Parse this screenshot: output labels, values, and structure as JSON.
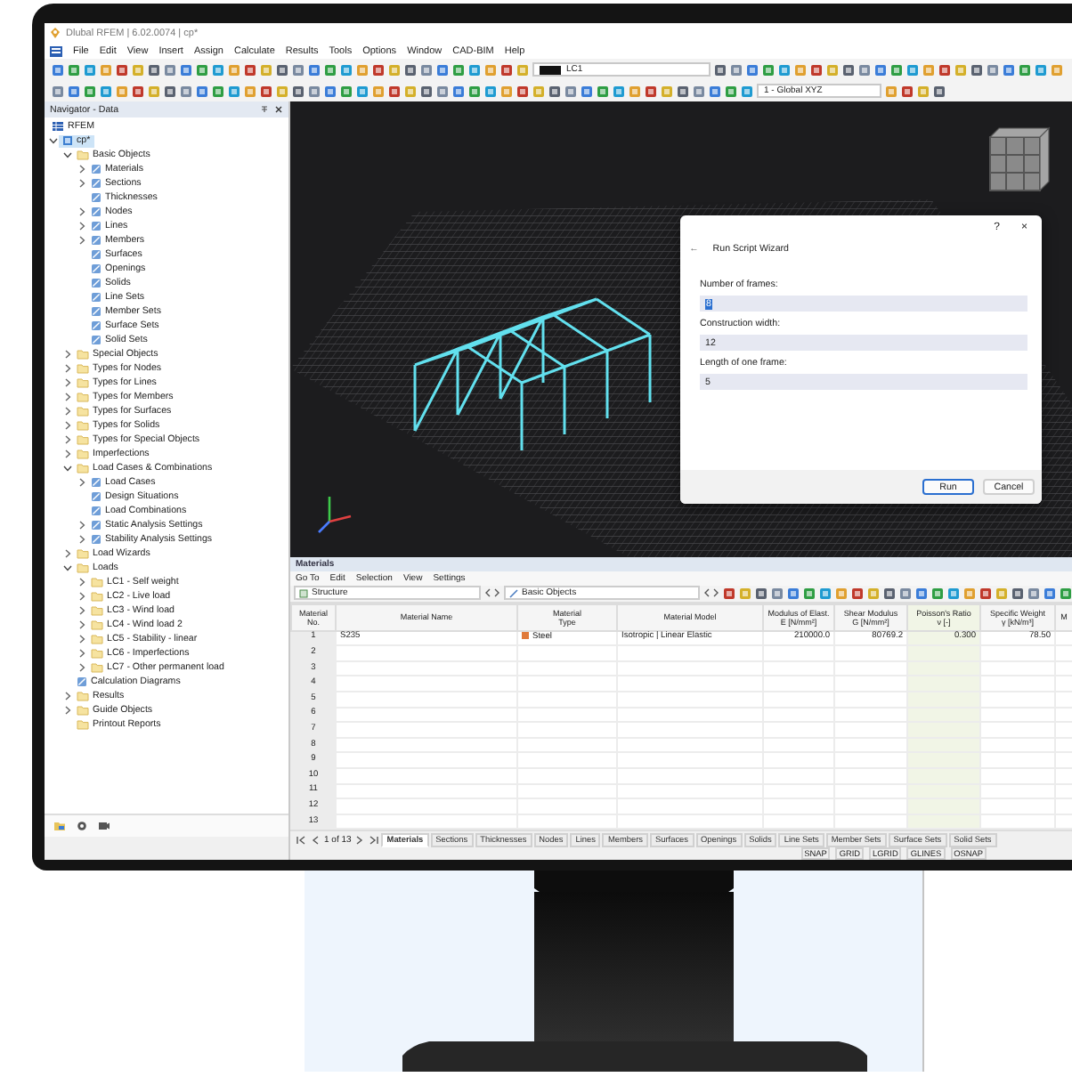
{
  "window": {
    "title": "Dlubal RFEM | 6.02.0074 | cp*"
  },
  "menu": [
    "File",
    "Edit",
    "View",
    "Insert",
    "Assign",
    "Calculate",
    "Results",
    "Tools",
    "Options",
    "Window",
    "CAD-BIM",
    "Help"
  ],
  "toolbar": {
    "load_case": "LC1",
    "view": "1 - Global XYZ"
  },
  "navigator": {
    "title": "Navigator - Data",
    "tree": [
      {
        "label": "RFEM",
        "kind": "app",
        "selected": false
      },
      {
        "label": "cp*",
        "kind": "model",
        "selected": true,
        "expanded": true,
        "children": [
          {
            "label": "Basic Objects",
            "kind": "folder",
            "selected": false,
            "expanded": true,
            "children": [
              {
                "label": "Materials",
                "kind": "object",
                "selected": false,
                "expanded": false
              },
              {
                "label": "Sections",
                "kind": "object",
                "selected": false,
                "expanded": false
              },
              {
                "label": "Thicknesses",
                "kind": "object",
                "selected": false
              },
              {
                "label": "Nodes",
                "kind": "object",
                "selected": false,
                "expanded": false
              },
              {
                "label": "Lines",
                "kind": "object",
                "selected": false,
                "expanded": false
              },
              {
                "label": "Members",
                "kind": "object",
                "selected": false,
                "expanded": false
              },
              {
                "label": "Surfaces",
                "kind": "object",
                "selected": false
              },
              {
                "label": "Openings",
                "kind": "object",
                "selected": false
              },
              {
                "label": "Solids",
                "kind": "object",
                "selected": false
              },
              {
                "label": "Line Sets",
                "kind": "object",
                "selected": false
              },
              {
                "label": "Member Sets",
                "kind": "object",
                "selected": false
              },
              {
                "label": "Surface Sets",
                "kind": "object",
                "selected": false
              },
              {
                "label": "Solid Sets",
                "kind": "object",
                "selected": false
              }
            ]
          },
          {
            "label": "Special Objects",
            "kind": "folder",
            "selected": false,
            "expanded": false
          },
          {
            "label": "Types for Nodes",
            "kind": "folder",
            "selected": false,
            "expanded": false
          },
          {
            "label": "Types for Lines",
            "kind": "folder",
            "selected": false,
            "expanded": false
          },
          {
            "label": "Types for Members",
            "kind": "folder",
            "selected": false,
            "expanded": false
          },
          {
            "label": "Types for Surfaces",
            "kind": "folder",
            "selected": false,
            "expanded": false
          },
          {
            "label": "Types for Solids",
            "kind": "folder",
            "selected": false,
            "expanded": false
          },
          {
            "label": "Types for Special Objects",
            "kind": "folder",
            "selected": false,
            "expanded": false
          },
          {
            "label": "Imperfections",
            "kind": "folder",
            "selected": false,
            "expanded": false
          },
          {
            "label": "Load Cases & Combinations",
            "kind": "folder",
            "selected": false,
            "expanded": true,
            "children": [
              {
                "label": "Load Cases",
                "kind": "object",
                "selected": false,
                "expanded": false
              },
              {
                "label": "Design Situations",
                "kind": "object",
                "selected": false
              },
              {
                "label": "Load Combinations",
                "kind": "object",
                "selected": false
              },
              {
                "label": "Static Analysis Settings",
                "kind": "object",
                "selected": false,
                "expanded": false
              },
              {
                "label": "Stability Analysis Settings",
                "kind": "object",
                "selected": false,
                "expanded": false
              }
            ]
          },
          {
            "label": "Load Wizards",
            "kind": "folder",
            "selected": false,
            "expanded": false
          },
          {
            "label": "Loads",
            "kind": "folder",
            "selected": false,
            "expanded": true,
            "children": [
              {
                "label": "LC1 - Self weight",
                "kind": "folder",
                "selected": false,
                "expanded": false
              },
              {
                "label": "LC2 - Live load",
                "kind": "folder",
                "selected": false,
                "expanded": false
              },
              {
                "label": "LC3 - Wind load",
                "kind": "folder",
                "selected": false,
                "expanded": false
              },
              {
                "label": "LC4 - Wind load 2",
                "kind": "folder",
                "selected": false,
                "expanded": false
              },
              {
                "label": "LC5 - Stability - linear",
                "kind": "folder",
                "selected": false,
                "expanded": false
              },
              {
                "label": "LC6 - Imperfections",
                "kind": "folder",
                "selected": false,
                "expanded": false
              },
              {
                "label": "LC7 - Other permanent load",
                "kind": "folder",
                "selected": false,
                "expanded": false
              }
            ]
          },
          {
            "label": "Calculation Diagrams",
            "kind": "object",
            "selected": false
          },
          {
            "label": "Results",
            "kind": "folder",
            "selected": false,
            "expanded": false
          },
          {
            "label": "Guide Objects",
            "kind": "folder",
            "selected": false,
            "expanded": false
          },
          {
            "label": "Printout Reports",
            "kind": "folder",
            "selected": false
          }
        ]
      }
    ]
  },
  "dialog": {
    "help": "?",
    "close": "×",
    "back": "←",
    "title": "Run Script Wizard",
    "fields": [
      {
        "label": "Number of frames:",
        "value": "8",
        "focused": true
      },
      {
        "label": "Construction width:",
        "value": "12",
        "focused": false
      },
      {
        "label": "Length of one frame:",
        "value": "5",
        "focused": false
      }
    ],
    "buttons": [
      {
        "label": "Run",
        "default": true
      },
      {
        "label": "Cancel",
        "default": false
      }
    ]
  },
  "materials": {
    "title": "Materials",
    "menu": [
      "Go To",
      "Edit",
      "Selection",
      "View",
      "Settings"
    ],
    "structure": "Structure",
    "filter": "Basic Objects",
    "table": {
      "columns": [
        {
          "label": "Material\nNo.",
          "kind": "index"
        },
        {
          "label": "Material Name",
          "kind": "text"
        },
        {
          "label": "Material\nType",
          "kind": "swatch"
        },
        {
          "label": "Material Model",
          "kind": "text"
        },
        {
          "label": "Modulus of Elast.\nE [N/mm²]",
          "kind": "number"
        },
        {
          "label": "Shear Modulus\nG [N/mm²]",
          "kind": "number"
        },
        {
          "label": "Poisson's Ratio\nν [-]",
          "kind": "number",
          "highlighted": true
        },
        {
          "label": "Specific Weight\nγ [kN/m³]",
          "kind": "number"
        },
        {
          "label": "M",
          "kind": "text"
        }
      ],
      "rows": [
        [
          "1",
          "S235",
          "Steel",
          "Isotropic | Linear Elastic",
          "210000.0",
          "80769.2",
          "0.300",
          "78.50"
        ],
        [
          "2"
        ],
        [
          "3"
        ],
        [
          "4"
        ],
        [
          "5"
        ],
        [
          "6"
        ],
        [
          "7"
        ],
        [
          "8"
        ],
        [
          "9"
        ],
        [
          "10"
        ],
        [
          "11"
        ],
        [
          "12"
        ],
        [
          "13"
        ]
      ]
    },
    "pager": "1 of 13",
    "tabs": [
      {
        "label": "Materials",
        "selected": true
      },
      {
        "label": "Sections",
        "selected": false
      },
      {
        "label": "Thicknesses",
        "selected": false
      },
      {
        "label": "Nodes",
        "selected": false
      },
      {
        "label": "Lines",
        "selected": false
      },
      {
        "label": "Members",
        "selected": false
      },
      {
        "label": "Surfaces",
        "selected": false
      },
      {
        "label": "Openings",
        "selected": false
      },
      {
        "label": "Solids",
        "selected": false
      },
      {
        "label": "Line Sets",
        "selected": false
      },
      {
        "label": "Member Sets",
        "selected": false
      },
      {
        "label": "Surface Sets",
        "selected": false
      },
      {
        "label": "Solid Sets",
        "selected": false
      }
    ]
  },
  "status_bar": [
    "SNAP",
    "GRID",
    "LGRID",
    "GLINES",
    "OSNAP"
  ]
}
